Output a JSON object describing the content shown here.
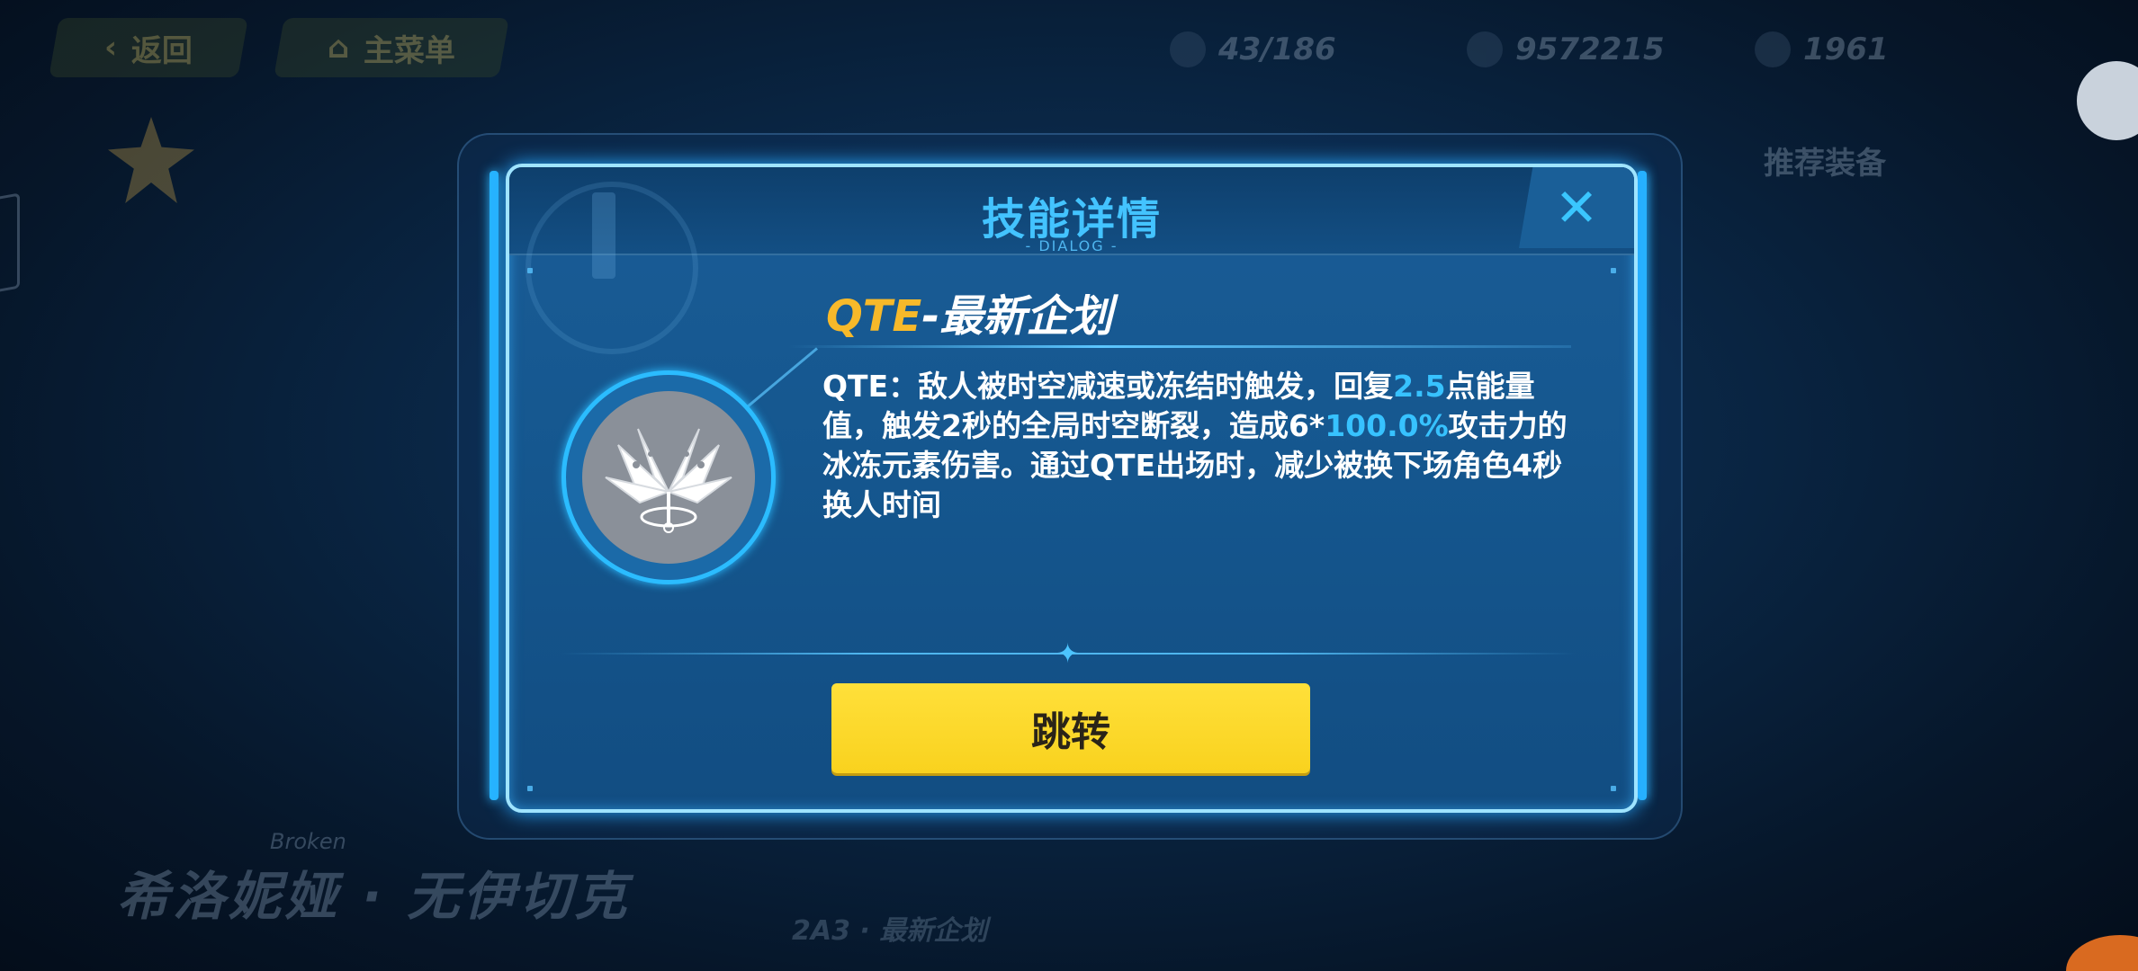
{
  "background": {
    "back_label": "返回",
    "main_menu_label": "主菜单",
    "resource_1": "43/186",
    "resource_2": "9572215",
    "resource_3": "1961",
    "recommended_equipment": "推荐装备",
    "character_name": "希洛妮娅 · 无伊切克",
    "character_sub": "Broken",
    "bottom_text": "2A3 · 最新企划"
  },
  "dialog": {
    "title": "技能详情",
    "subtitle": "- DIALOG -",
    "close_icon": "close-icon",
    "skill": {
      "name_prefix": "QTE",
      "name_suffix": "-最新企划",
      "icon": "ice-crystal-flower-icon",
      "description": {
        "part1": "QTE：敌人被时空减速或冻结时触发，回复",
        "value1": "2.5",
        "part2": "点能量值，触发2秒的全局时空断裂，造成6*",
        "value2": "100.0%",
        "part3": "攻击力的冰冻元素伤害。通过QTE出场时，减少被换下场角色4秒换人时间"
      }
    },
    "jump_button_label": "跳转"
  },
  "colors": {
    "accent_blue": "#43c3ff",
    "highlight": "#37c2ff",
    "qte_orange": "#f7b92a",
    "button_yellow": "#ffe03a"
  }
}
